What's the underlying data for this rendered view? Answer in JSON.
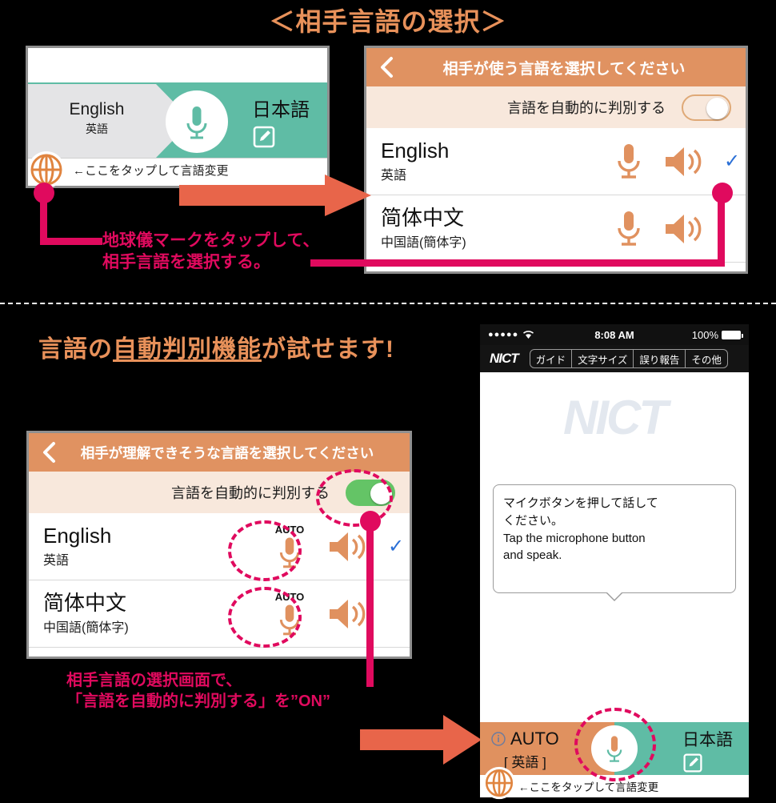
{
  "section_top": {
    "title": "＜相手言語の選択＞",
    "phone_left": {
      "source_lang": "English",
      "source_lang_sub": "英語",
      "target_lang": "日本語",
      "hint": "←ここをタップして言語変更",
      "globe_icon": "globe-icon",
      "mic_icon": "microphone-icon",
      "edit_icon": "edit-pencil-icon"
    },
    "phone_right": {
      "header_title": "相手が使う言語を選択してください",
      "back_icon": "chevron-left-icon",
      "auto_label": "言語を自動的に判別する",
      "toggle_state": "off",
      "rows": [
        {
          "name": "English",
          "sub": "英語",
          "mic_icon": "microphone-icon",
          "speaker_icon": "speaker-icon",
          "selected": true,
          "check": "✓"
        },
        {
          "name": "简体中文",
          "sub": "中国語(簡体字)",
          "mic_icon": "microphone-icon",
          "speaker_icon": "speaker-icon",
          "selected": false,
          "check": ""
        }
      ]
    },
    "annotation": {
      "line1": "地球儀マークをタップして、",
      "line2": "相手言語を選択する。"
    }
  },
  "section_bottom": {
    "heading_pre": "言語の",
    "heading_underlined": "自動判別機能",
    "heading_post": "が試せます!",
    "phone_left": {
      "header_title": "相手が理解できそうな言語を選択してください",
      "back_icon": "chevron-left-icon",
      "auto_label": "言語を自動的に判別する",
      "toggle_state": "on",
      "rows": [
        {
          "name": "English",
          "sub": "英語",
          "auto_badge": "AUTO",
          "mic_icon": "microphone-icon",
          "speaker_icon": "speaker-icon",
          "selected": true,
          "check": "✓"
        },
        {
          "name": "简体中文",
          "sub": "中国語(簡体字)",
          "auto_badge": "AUTO",
          "mic_icon": "microphone-icon",
          "speaker_icon": "speaker-icon",
          "selected": false,
          "check": ""
        }
      ]
    },
    "annotation": {
      "line1": "相手言語の選択画面で、",
      "line2": "「言語を自動的に判別する」を”ON”"
    },
    "phone_right": {
      "status": {
        "signal": "●●●●●",
        "wifi_icon": "wifi-icon",
        "time": "8:08 AM",
        "battery_percent": "100%",
        "battery_icon": "battery-full-icon"
      },
      "toolbar": {
        "logo": "NICT",
        "buttons": [
          "ガイド",
          "文字サイズ",
          "誤り報告",
          "その他"
        ]
      },
      "watermark": "NICT",
      "bubble_lines": [
        "マイクボタンを押して話して",
        "ください。",
        "Tap the microphone button",
        "and speak."
      ],
      "bottom_bar": {
        "info_icon": "info-circle-icon",
        "auto_label": "AUTO",
        "auto_sub": "[ 英語 ]",
        "target_lang": "日本語",
        "mic_icon": "microphone-icon",
        "edit_icon": "edit-pencil-icon"
      },
      "hint": "←ここをタップして言語変更",
      "globe_icon": "globe-icon"
    }
  },
  "colors": {
    "orange_header": "#E09261",
    "teal": "#5FBCA5",
    "pink": "#E00A5E",
    "arrow": "#E8654A",
    "title_orange": "#E8915A",
    "check_blue": "#2A6FD6",
    "toggle_on_green": "#64C466"
  }
}
